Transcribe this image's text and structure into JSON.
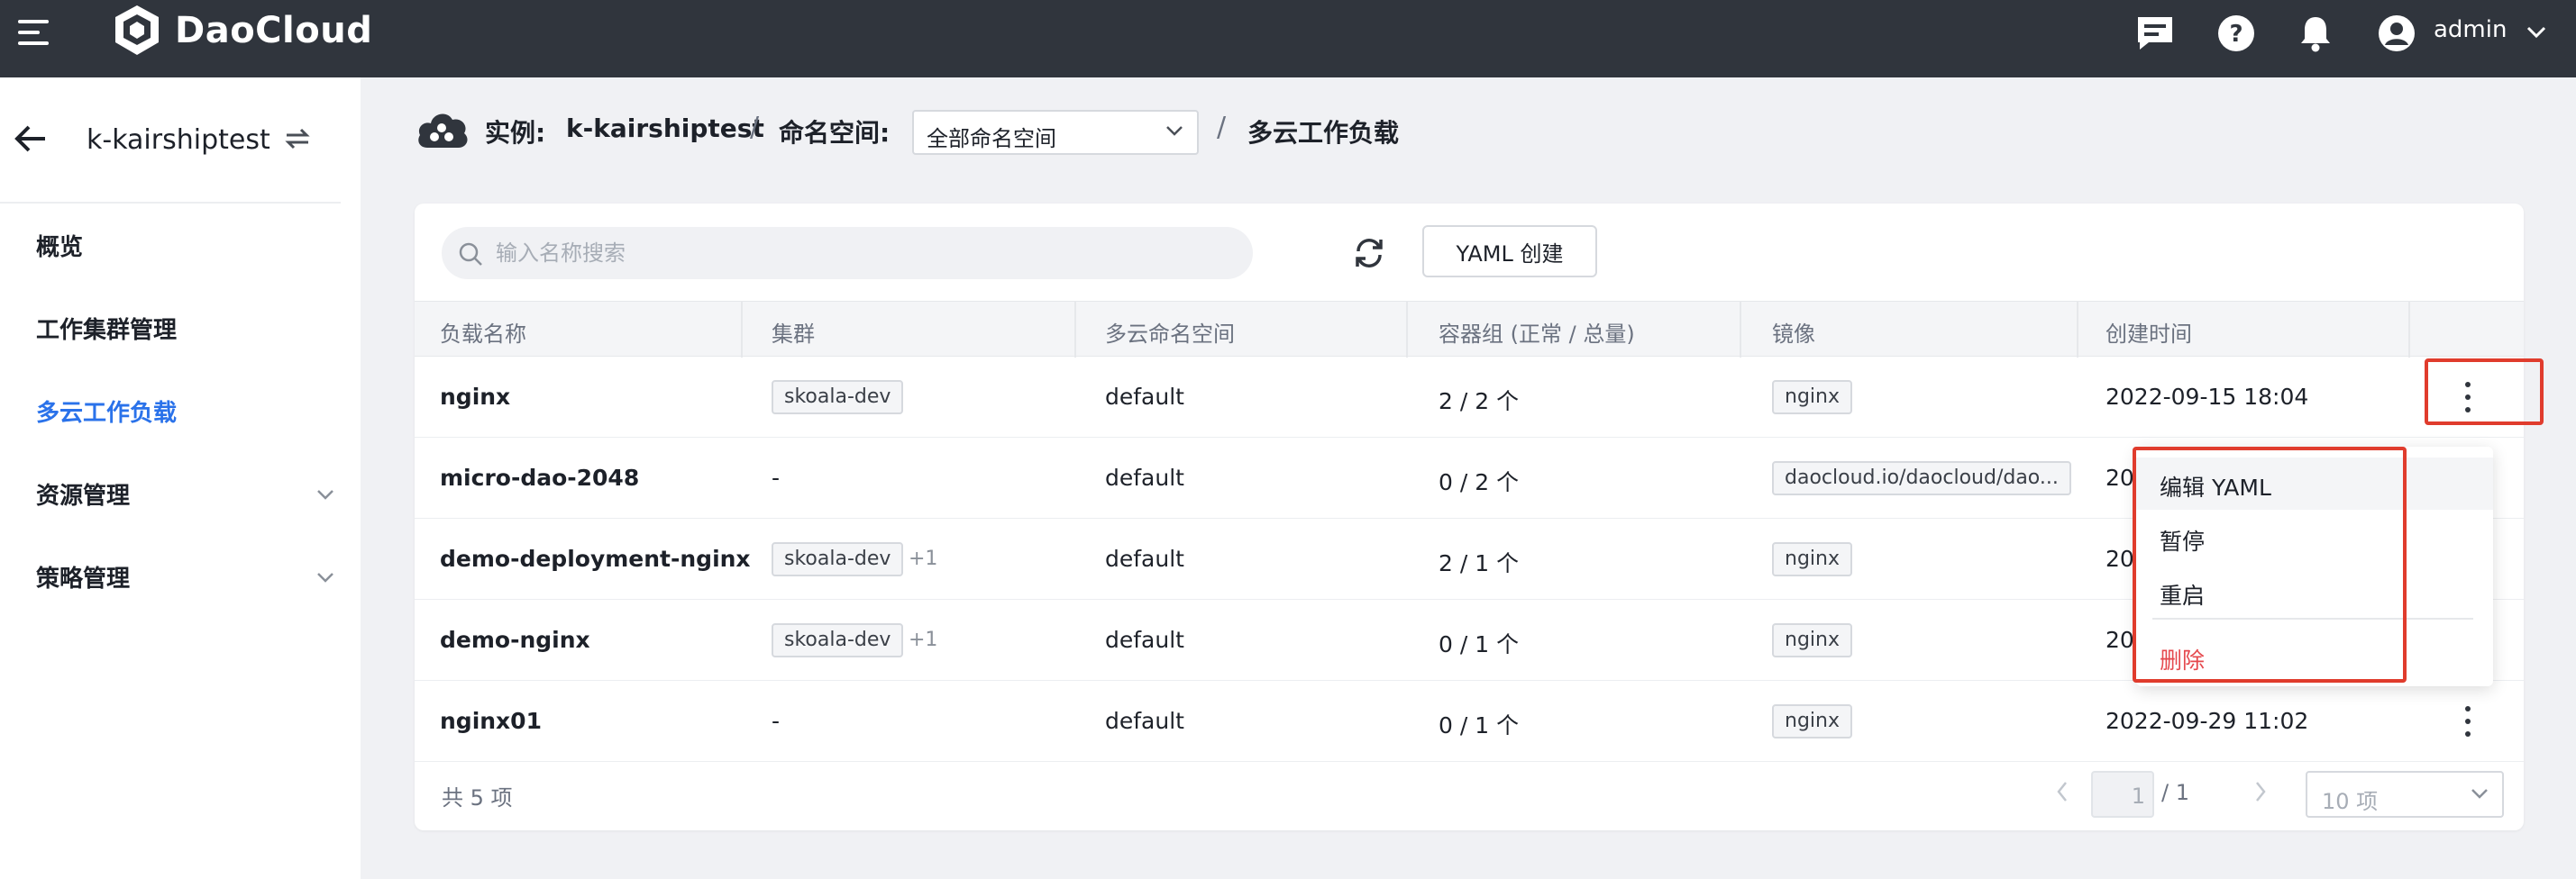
{
  "topbar": {
    "brand": "DaoCloud",
    "user": "admin"
  },
  "sidebar": {
    "cluster_name": "k-kairshiptest",
    "items": [
      {
        "label": "概览"
      },
      {
        "label": "工作集群管理"
      },
      {
        "label": "多云工作负载",
        "active": true
      },
      {
        "label": "资源管理"
      },
      {
        "label": "策略管理"
      }
    ]
  },
  "breadcrumb": {
    "instance_label": "实例:",
    "instance_name": "k-kairshiptest",
    "sep": "/",
    "namespace_label": "命名空间:",
    "namespace_value": "全部命名空间",
    "current": "多云工作负载"
  },
  "toolbar": {
    "search_placeholder": "输入名称搜索",
    "create_button": "YAML 创建"
  },
  "table": {
    "columns": [
      "负载名称",
      "集群",
      "多云命名空间",
      "容器组 (正常 / 总量)",
      "镜像",
      "创建时间"
    ],
    "rows": [
      {
        "name": "nginx",
        "cluster": "skoala-dev",
        "cluster_extra": "",
        "namespace": "default",
        "pods": "2 / 2 个",
        "image": "nginx",
        "created": "2022-09-15 18:04"
      },
      {
        "name": "micro-dao-2048",
        "cluster": "-",
        "cluster_extra": "",
        "namespace": "default",
        "pods": "0 / 2 个",
        "image": "daocloud.io/daocloud/dao...",
        "created": "20"
      },
      {
        "name": "demo-deployment-nginx",
        "cluster": "skoala-dev",
        "cluster_extra": "+1",
        "namespace": "default",
        "pods": "2 / 1 个",
        "image": "nginx",
        "created": "20"
      },
      {
        "name": "demo-nginx",
        "cluster": "skoala-dev",
        "cluster_extra": "+1",
        "namespace": "default",
        "pods": "0 / 1 个",
        "image": "nginx",
        "created": "20"
      },
      {
        "name": "nginx01",
        "cluster": "-",
        "cluster_extra": "",
        "namespace": "default",
        "pods": "0 / 1 个",
        "image": "nginx",
        "created": "2022-09-29 11:02"
      }
    ]
  },
  "footer": {
    "total": "共 5 项",
    "page": "1",
    "page_total": "/ 1",
    "page_size": "10 项"
  },
  "menu": {
    "items": [
      {
        "label": "编辑 YAML"
      },
      {
        "label": "暂停"
      },
      {
        "label": "重启"
      },
      {
        "label": "删除"
      }
    ]
  },
  "colors": {
    "topbar": "#30353d",
    "accent": "#2a72ea",
    "danger": "#e5484d",
    "highlight": "#e03c2d"
  }
}
